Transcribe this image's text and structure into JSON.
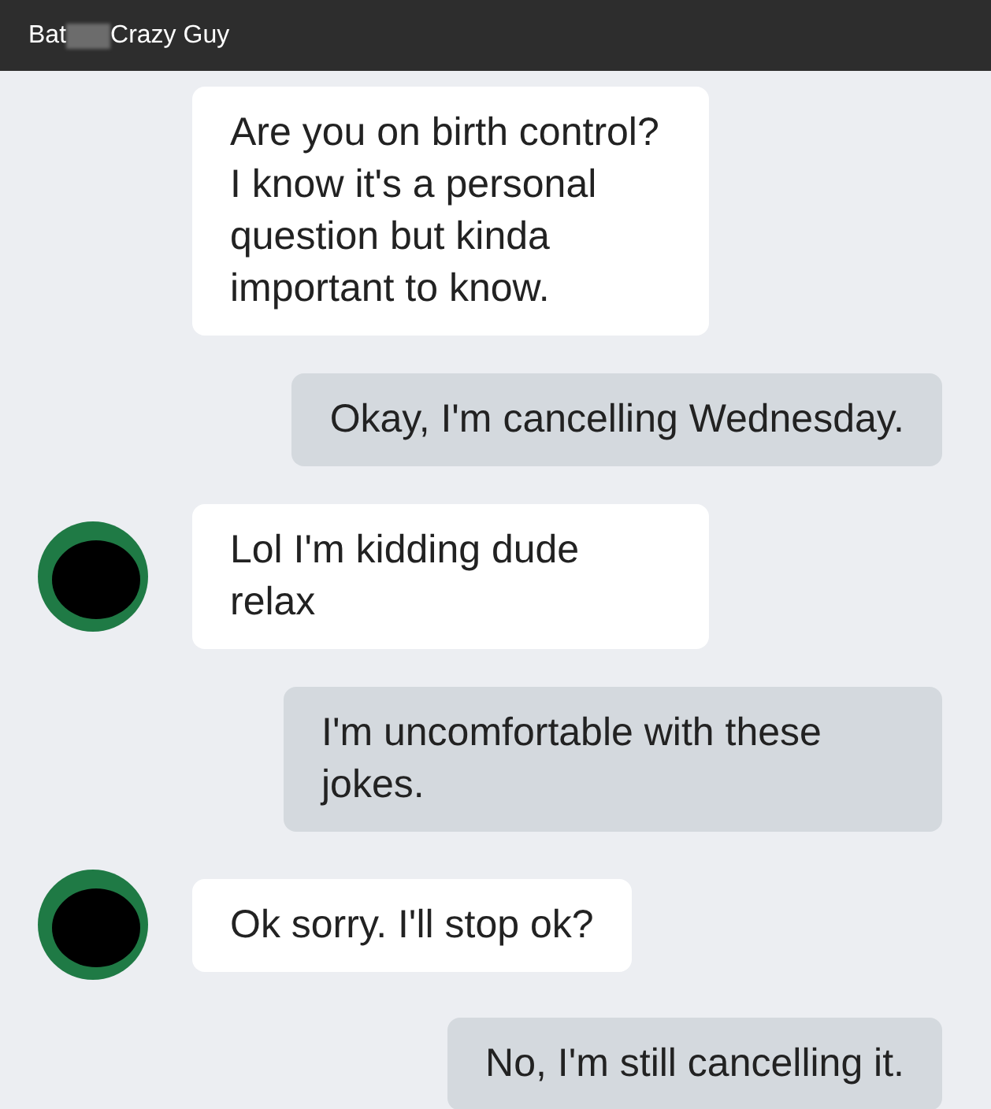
{
  "header": {
    "title_start": "Bat",
    "title_hidden": true,
    "title_end": "Crazy Guy"
  },
  "messages": [
    {
      "kind": "incoming",
      "avatar": false,
      "text": "Are you on birth control? I know it's a personal question but kinda important to know."
    },
    {
      "kind": "outgoing",
      "text": "Okay, I'm cancelling Wednesday."
    },
    {
      "kind": "incoming",
      "avatar": true,
      "text": "Lol I'm kidding dude relax"
    },
    {
      "kind": "outgoing",
      "text": "I'm uncomfortable with these jokes."
    },
    {
      "kind": "incoming",
      "avatar": true,
      "text": "Ok sorry. I'll stop ok?"
    },
    {
      "kind": "outgoing",
      "text": "No, I'm still cancelling it."
    }
  ]
}
